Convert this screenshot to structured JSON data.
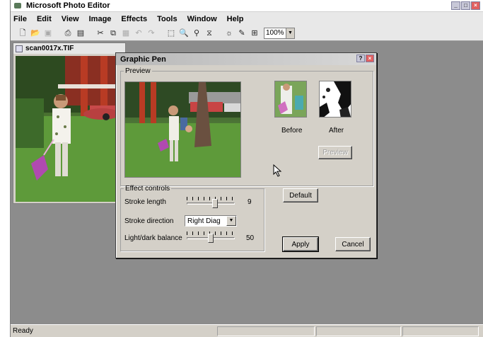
{
  "window": {
    "title": "Microsoft Photo Editor",
    "btn_min": "_",
    "btn_max": "□",
    "btn_close": "×"
  },
  "menu": [
    "File",
    "Edit",
    "View",
    "Image",
    "Effects",
    "Tools",
    "Window",
    "Help"
  ],
  "toolbar": {
    "icons": [
      "new-icon",
      "open-icon",
      "save-icon",
      "print-icon",
      "scan-icon",
      "cut-icon",
      "copy-icon",
      "paste-icon",
      "undo-icon",
      "redo-icon",
      "select-icon",
      "zoom-icon",
      "stamp-icon",
      "filter-icon",
      "sun-icon",
      "pen-icon",
      "text-icon"
    ],
    "zoom_value": "100%"
  },
  "image_window": {
    "title": "scan0017x.TIF"
  },
  "dialog": {
    "title": "Graphic Pen",
    "help_btn": "?",
    "close_btn": "×",
    "preview_group": "Preview",
    "before_label": "Before",
    "after_label": "After",
    "preview_button": "Preview",
    "effect_group": "Effect controls",
    "stroke_length_label": "Stroke length",
    "stroke_length_value": "9",
    "stroke_direction_label": "Stroke direction",
    "stroke_direction_value": "Right Diag",
    "balance_label": "Light/dark balance",
    "balance_value": "50",
    "default_button": "Default",
    "apply_button": "Apply",
    "cancel_button": "Cancel"
  },
  "status": {
    "text": "Ready"
  }
}
